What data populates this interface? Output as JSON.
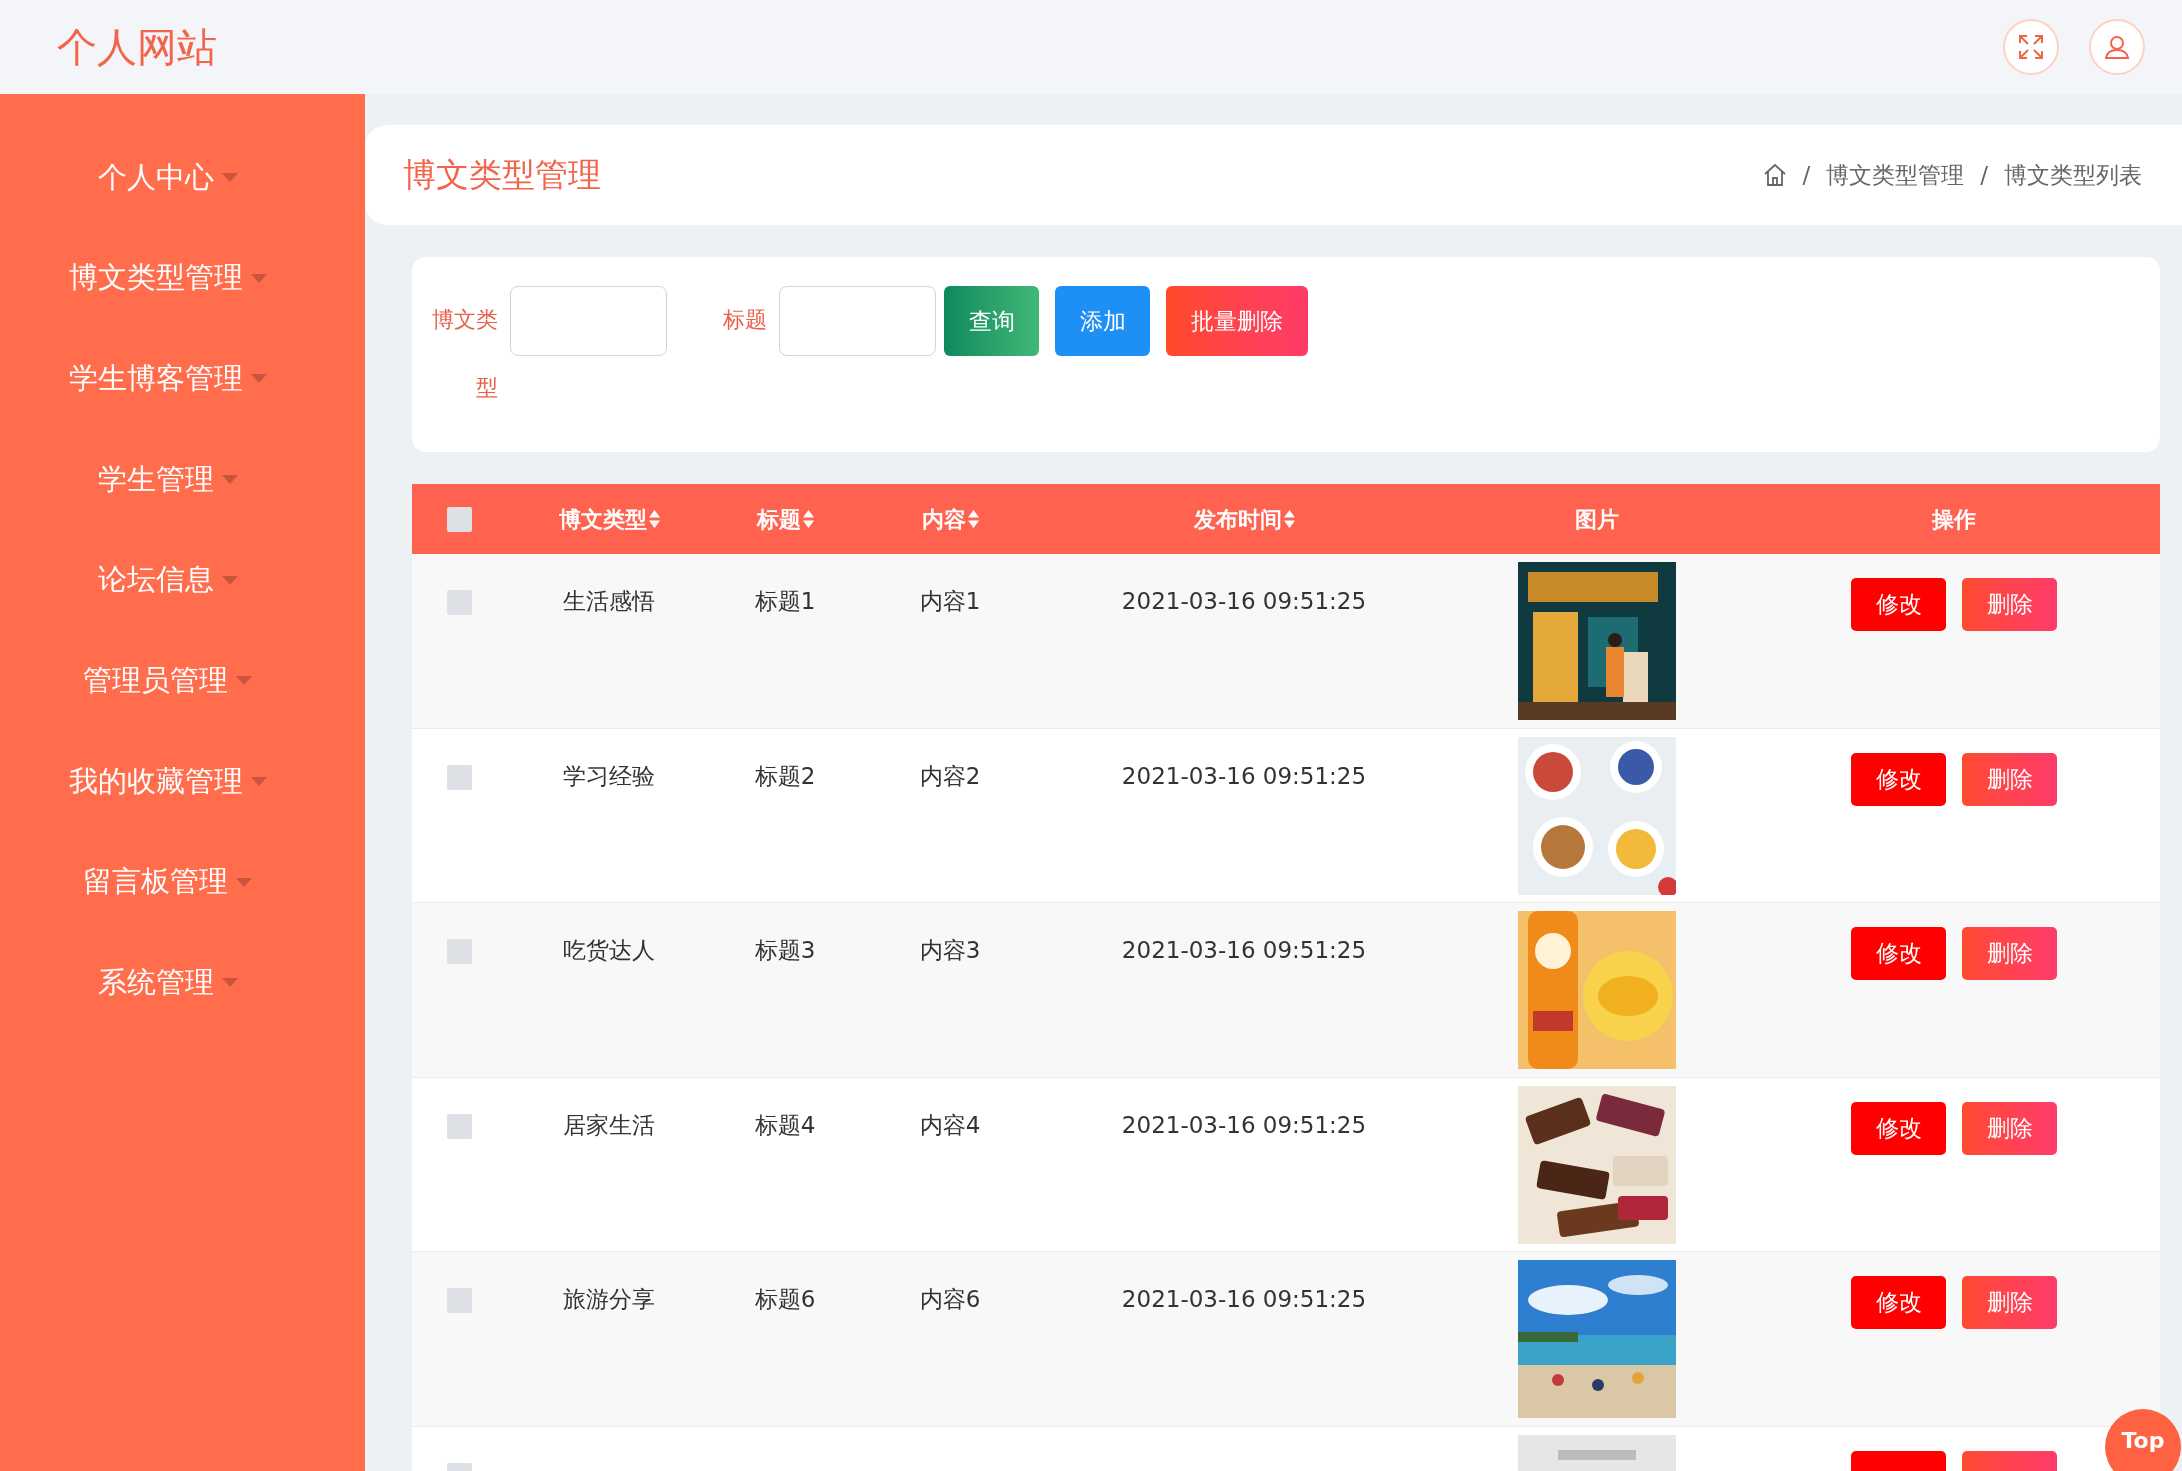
{
  "site_title": "个人网站",
  "sidebar": {
    "items": [
      {
        "label": "个人中心"
      },
      {
        "label": "博文类型管理"
      },
      {
        "label": "学生博客管理"
      },
      {
        "label": "学生管理"
      },
      {
        "label": "论坛信息"
      },
      {
        "label": "管理员管理"
      },
      {
        "label": "我的收藏管理"
      },
      {
        "label": "留言板管理"
      },
      {
        "label": "系统管理"
      }
    ]
  },
  "page": {
    "title": "博文类型管理",
    "breadcrumb": [
      {
        "separator": "/",
        "label": "博文类型管理"
      },
      {
        "separator": "/",
        "label": "博文类型列表"
      }
    ]
  },
  "search": {
    "fields": [
      {
        "label": "博文类型"
      },
      {
        "label": "标题"
      }
    ],
    "buttons": [
      {
        "label": "查询",
        "kind": "query"
      },
      {
        "label": "添加",
        "kind": "add"
      },
      {
        "label": "批量删除",
        "kind": "batch_delete"
      }
    ]
  },
  "table": {
    "select_all_checked": false,
    "columns": [
      {
        "label": "博文类型",
        "sortable": true
      },
      {
        "label": "标题",
        "sortable": true
      },
      {
        "label": "内容",
        "sortable": true
      },
      {
        "label": "发布时间",
        "sortable": true
      },
      {
        "label": "图片",
        "sortable": false
      },
      {
        "label": "操作",
        "sortable": false
      }
    ],
    "rows": [
      {
        "checked": false,
        "type": "生活感悟",
        "title": "标题1",
        "content": "内容1",
        "time": "2021-03-16 09:51:25",
        "actions": [
          "修改",
          "删除"
        ]
      },
      {
        "checked": false,
        "type": "学习经验",
        "title": "标题2",
        "content": "内容2",
        "time": "2021-03-16 09:51:25",
        "actions": [
          "修改",
          "删除"
        ]
      },
      {
        "checked": false,
        "type": "吃货达人",
        "title": "标题3",
        "content": "内容3",
        "time": "2021-03-16 09:51:25",
        "actions": [
          "修改",
          "删除"
        ]
      },
      {
        "checked": false,
        "type": "居家生活",
        "title": "标题4",
        "content": "内容4",
        "time": "2021-03-16 09:51:25",
        "actions": [
          "修改",
          "删除"
        ]
      },
      {
        "checked": false,
        "type": "旅游分享",
        "title": "标题6",
        "content": "内容6",
        "time": "2021-03-16 09:51:25",
        "actions": [
          "修改",
          "删除"
        ]
      },
      {
        "checked": false,
        "actions": [
          {
            "kind": "edit"
          },
          {
            "kind": "delete"
          }
        ]
      }
    ]
  },
  "top_button": "Top"
}
